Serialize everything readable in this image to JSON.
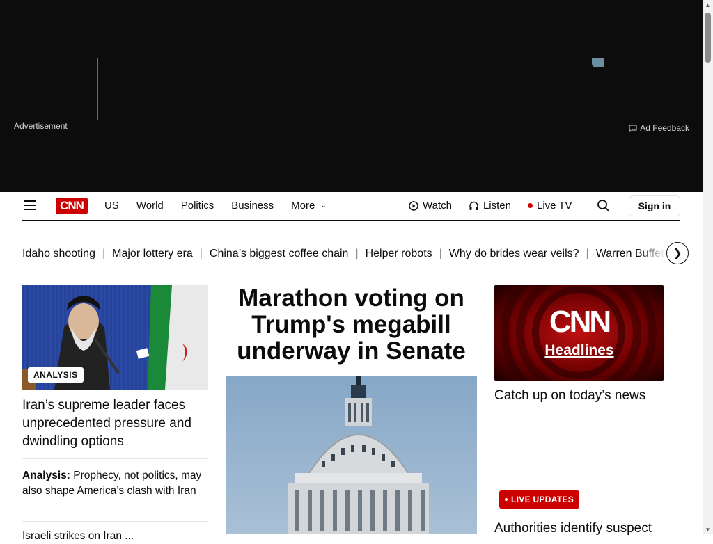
{
  "ad": {
    "label": "Advertisement",
    "feedback": "Ad Feedback"
  },
  "header": {
    "logo": "CNN",
    "nav": [
      "US",
      "World",
      "Politics",
      "Business",
      "More"
    ],
    "watch": "Watch",
    "listen": "Listen",
    "live_tv": "Live TV",
    "sign_in": "Sign in"
  },
  "trending": [
    "Idaho shooting",
    "Major lottery era",
    "China’s biggest coffee chain",
    "Helper robots",
    "Why do brides wear veils?",
    "Warren Buffett"
  ],
  "left": {
    "badge": "ANALYSIS",
    "title": "Iran’s supreme leader faces unprecedented pressure and dwindling options",
    "sub_prefix": "Analysis:",
    "sub_text": "Prophecy, not politics, may also shape America’s clash with Iran",
    "more": "Israeli strikes on Iran ..."
  },
  "center": {
    "headline": "Marathon voting on Trump's megabill underway in Senate"
  },
  "right": {
    "video_logo": "CNN",
    "video_label": "Headlines",
    "title": "Catch up on today’s news",
    "live_badge": "LIVE UPDATES",
    "title2": "Authorities identify suspect"
  },
  "colors": {
    "brand_red": "#cc0000",
    "ad_bg": "#0c0c0c"
  }
}
